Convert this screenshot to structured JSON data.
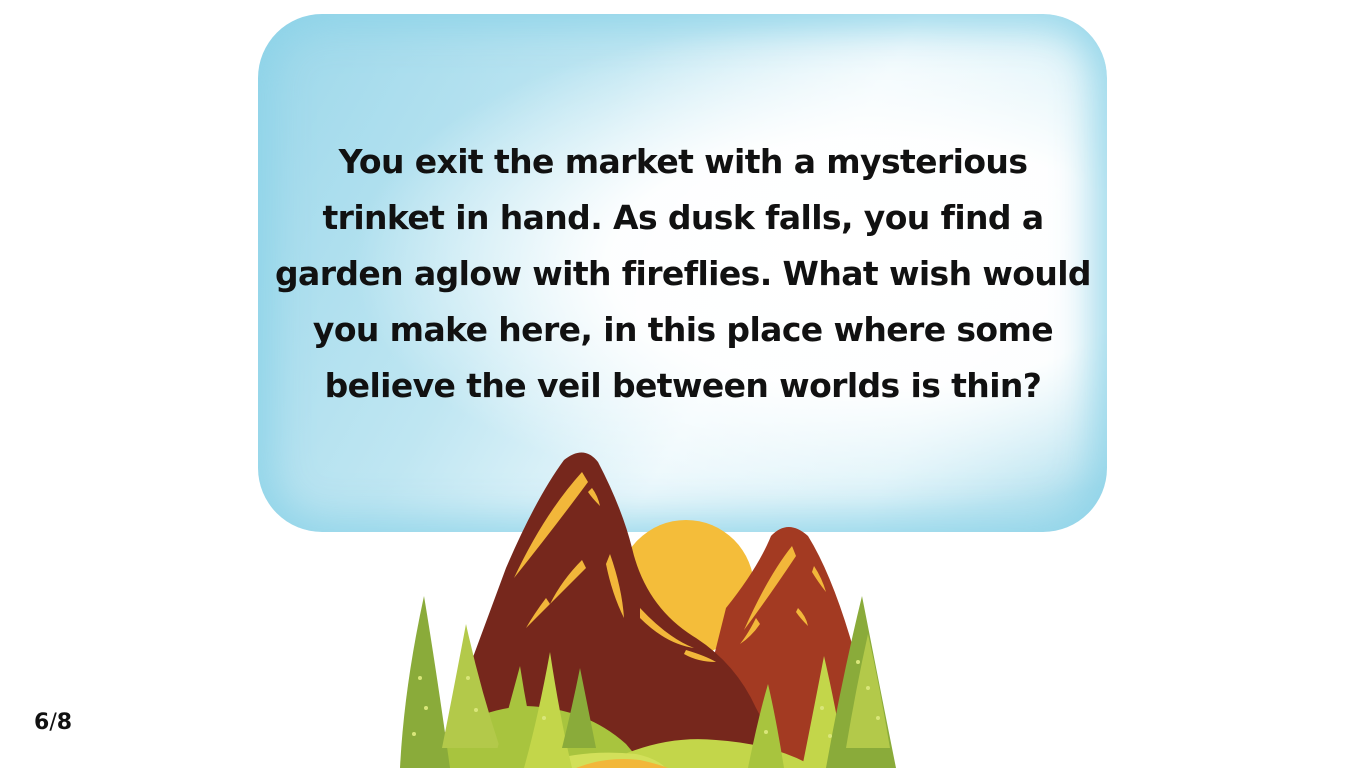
{
  "story": {
    "text": "You exit the market with a mysterious trinket in hand. As dusk falls, you find a garden aglow with fireflies. What wish would you make here, in this place where some believe the veil between worlds is thin?"
  },
  "pagination": {
    "current": "6",
    "separator": "/",
    "total": "8"
  },
  "colors": {
    "cloud": "#a8dcec",
    "sun": "#f4bd3a",
    "mountain_dark": "#76271c",
    "mountain_light": "#a33a22",
    "highlight": "#f2b73a",
    "tree_green": "#8aab3a",
    "tree_light": "#c3d64a",
    "hill_green": "#a8c43e"
  },
  "illustration": {
    "icon": "mountain-landscape-icon"
  }
}
